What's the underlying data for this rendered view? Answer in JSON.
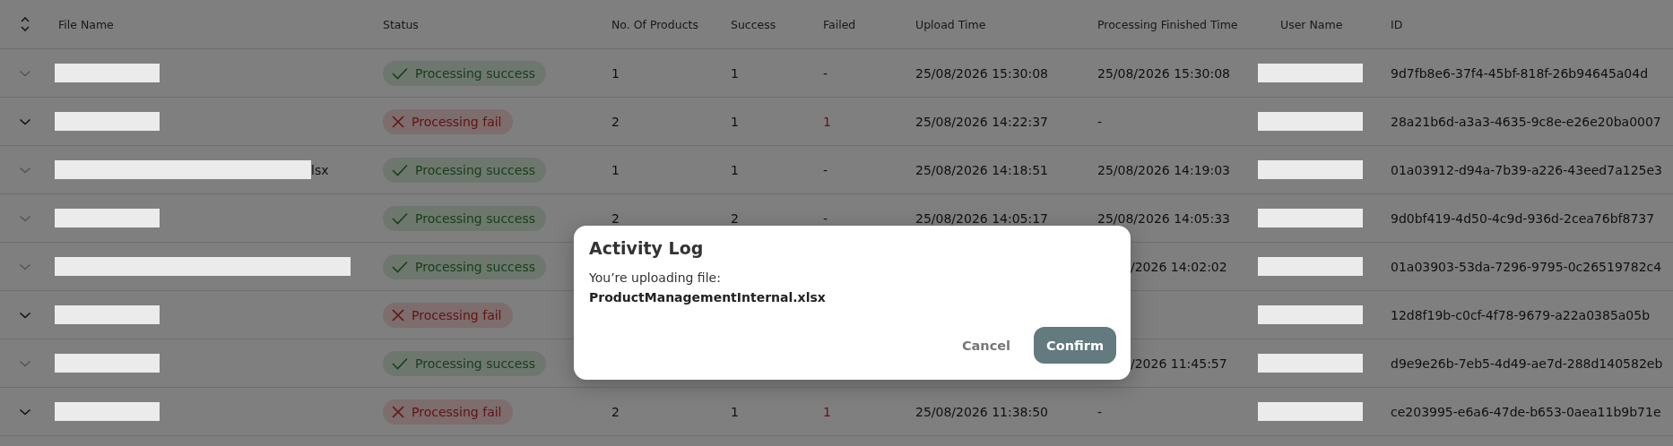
{
  "table": {
    "columns": [
      "File Name",
      "Status",
      "No. Of Products",
      "Success",
      "Failed",
      "Upload Time",
      "Processing Finished Time",
      "User Name",
      "ID"
    ],
    "rows": [
      {
        "expandable": false,
        "file_redaction": {
          "kind": "short"
        },
        "status": {
          "kind": "success",
          "text": "Processing success"
        },
        "products": "1",
        "success": "1",
        "failed": "-",
        "upload_time": "25/08/2026 15:30:08",
        "finished_time": "25/08/2026 15:30:08",
        "user_redacted": true,
        "id": "9d7fb8e6-37f4-45bf-818f-26b94645a04d"
      },
      {
        "expandable": true,
        "file_redaction": {
          "kind": "short"
        },
        "status": {
          "kind": "fail",
          "text": "Processing fail"
        },
        "products": "2",
        "success": "1",
        "failed": "1",
        "upload_time": "25/08/2026 14:22:37",
        "finished_time": "-",
        "user_redacted": true,
        "id": "28a21b6d-a3a3-4635-9c8e-e26e20ba0007"
      },
      {
        "expandable": false,
        "file_redaction": {
          "kind": "medium"
        },
        "file_suffix": "lsx",
        "status": {
          "kind": "success",
          "text": "Processing success"
        },
        "products": "1",
        "success": "1",
        "failed": "-",
        "upload_time": "25/08/2026 14:18:51",
        "finished_time": "25/08/2026 14:19:03",
        "user_redacted": true,
        "id": "01a03912-d94a-7b39-a226-43eed7a125e3"
      },
      {
        "expandable": false,
        "file_redaction": {
          "kind": "short"
        },
        "status": {
          "kind": "success",
          "text": "Processing success"
        },
        "products": "2",
        "success": "2",
        "failed": "-",
        "upload_time": "25/08/2026 14:05:17",
        "finished_time": "25/08/2026 14:05:33",
        "user_redacted": true,
        "id": "9d0bf419-4d50-4c9d-936d-2cea76bf8737"
      },
      {
        "expandable": false,
        "file_redaction": {
          "kind": "long"
        },
        "status": {
          "kind": "success",
          "text": "Processing success"
        },
        "finished_time": "/2026 14:02:02",
        "finished_cut": true,
        "user_redacted": true,
        "id": "01a03903-53da-7296-9795-0c26519782c4"
      },
      {
        "expandable": true,
        "file_redaction": {
          "kind": "short"
        },
        "status": {
          "kind": "fail",
          "text": "Processing fail"
        },
        "user_redacted": true,
        "id": "12d8f19b-c0cf-4f78-9679-a22a0385a05b"
      },
      {
        "expandable": false,
        "file_redaction": {
          "kind": "short"
        },
        "status": {
          "kind": "success",
          "text": "Processing success"
        },
        "finished_time": "/2026 11:45:57",
        "finished_cut": true,
        "user_redacted": true,
        "id": "d9e9e26b-7eb5-4d49-ae7d-288d140582eb"
      },
      {
        "expandable": true,
        "file_redaction": {
          "kind": "short"
        },
        "status": {
          "kind": "fail",
          "text": "Processing fail"
        },
        "products": "2",
        "success": "1",
        "failed": "1",
        "upload_time": "25/08/2026 11:38:50",
        "finished_time": "-",
        "user_redacted": true,
        "id": "ce203995-e6a6-47de-b653-0aea11b9b71e"
      }
    ]
  },
  "dialog": {
    "title": "Activity Log",
    "message": "You’re uploading file:",
    "file_name": "ProductManagementInternal.xlsx",
    "buttons": [
      {
        "kind": "text",
        "label": "Cancel"
      },
      {
        "kind": "primary",
        "label": "Confirm"
      }
    ]
  }
}
